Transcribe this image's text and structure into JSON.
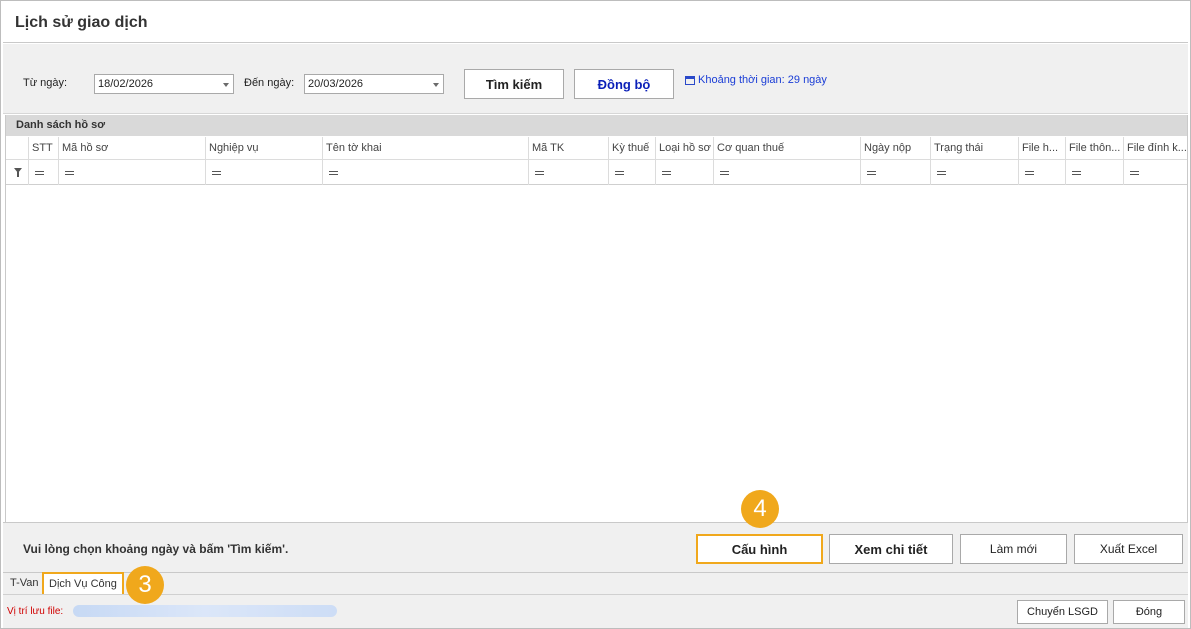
{
  "window": {
    "title": "Lịch sử giao dịch"
  },
  "filters": {
    "from_label": "Từ ngày:",
    "from_value": "18/02/2026",
    "to_label": "Đến ngày:",
    "to_value": "20/03/2026",
    "search_button": "Tìm kiếm",
    "sync_button": "Đồng bộ",
    "range_link": "Khoảng thời gian: 29 ngày"
  },
  "grid": {
    "caption": "Danh sách hồ sơ",
    "columns": [
      "STT",
      "Mã hồ sơ",
      "Nghiệp vụ",
      "Tên tờ khai",
      "Mã TK",
      "Kỳ thuế",
      "Loại hồ sơ",
      "Cơ quan thuế",
      "Ngày nộp",
      "Trạng thái",
      "File h...",
      "File thôn...",
      "File đính k..."
    ],
    "rows": []
  },
  "status": {
    "message": "Vui lòng chọn khoảng ngày và bấm 'Tìm kiếm'.",
    "config_button": "Cấu hình",
    "detail_button": "Xem chi tiết",
    "refresh_button": "Làm mới",
    "export_button": "Xuất Excel"
  },
  "tabs": [
    {
      "label": "T-Van",
      "active": false
    },
    {
      "label": "Dịch Vụ Công",
      "active": true
    }
  ],
  "footer": {
    "path_label": "Vị trí lưu file:",
    "transfer_button": "Chuyển LSGD",
    "close_button": "Đóng"
  },
  "annotations": {
    "step_tab": "3",
    "step_config": "4"
  },
  "colors": {
    "highlight": "#f0a81c",
    "link": "#1a3dd6",
    "sync_text": "#0a1fb8",
    "path_label": "#d00000"
  }
}
